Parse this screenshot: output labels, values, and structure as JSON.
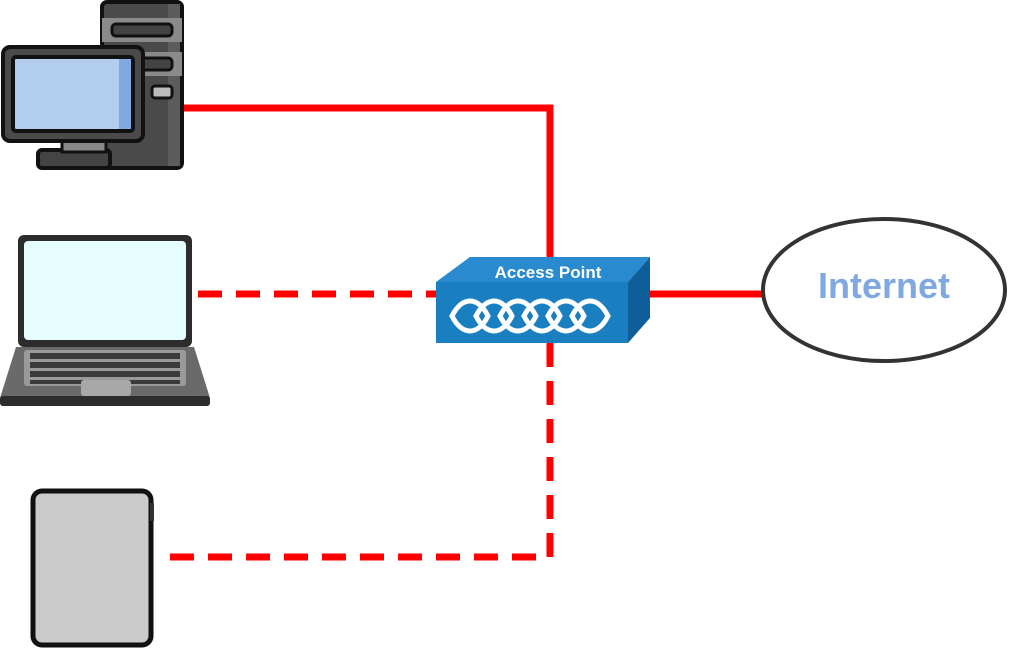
{
  "access_point": {
    "label": "Access Point",
    "color": "#1a7fc1"
  },
  "internet": {
    "label": "Internet",
    "text_color": "#7fa9e0"
  },
  "links": {
    "color": "#ff0000",
    "wired": [
      "desktop",
      "internet"
    ],
    "wireless": [
      "laptop",
      "tablet"
    ]
  }
}
